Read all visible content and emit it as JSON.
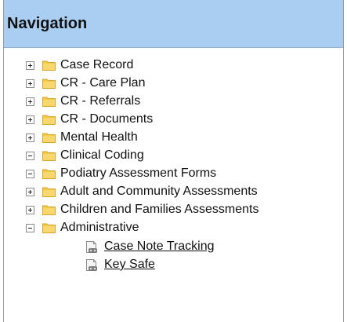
{
  "header": {
    "title": "Navigation"
  },
  "tree": [
    {
      "label": "Case Record",
      "state": "collapsed"
    },
    {
      "label": "CR - Care Plan",
      "state": "collapsed"
    },
    {
      "label": "CR - Referrals",
      "state": "collapsed"
    },
    {
      "label": "CR - Documents",
      "state": "collapsed"
    },
    {
      "label": "Mental Health",
      "state": "collapsed"
    },
    {
      "label": "Clinical Coding",
      "state": "expanded"
    },
    {
      "label": "Podiatry Assessment Forms",
      "state": "expanded"
    },
    {
      "label": "Adult and Community Assessments",
      "state": "collapsed"
    },
    {
      "label": "Children and Families Assessments",
      "state": "collapsed"
    },
    {
      "label": "Administrative",
      "state": "expanded",
      "children": [
        {
          "label": "Case Note Tracking",
          "icon": "form-icon"
        },
        {
          "label": "Key Safe",
          "icon": "form-icon"
        }
      ]
    }
  ],
  "colors": {
    "header_bg": "#aacdf2",
    "folder": "#f3c94c",
    "border": "#9a9a9a"
  }
}
